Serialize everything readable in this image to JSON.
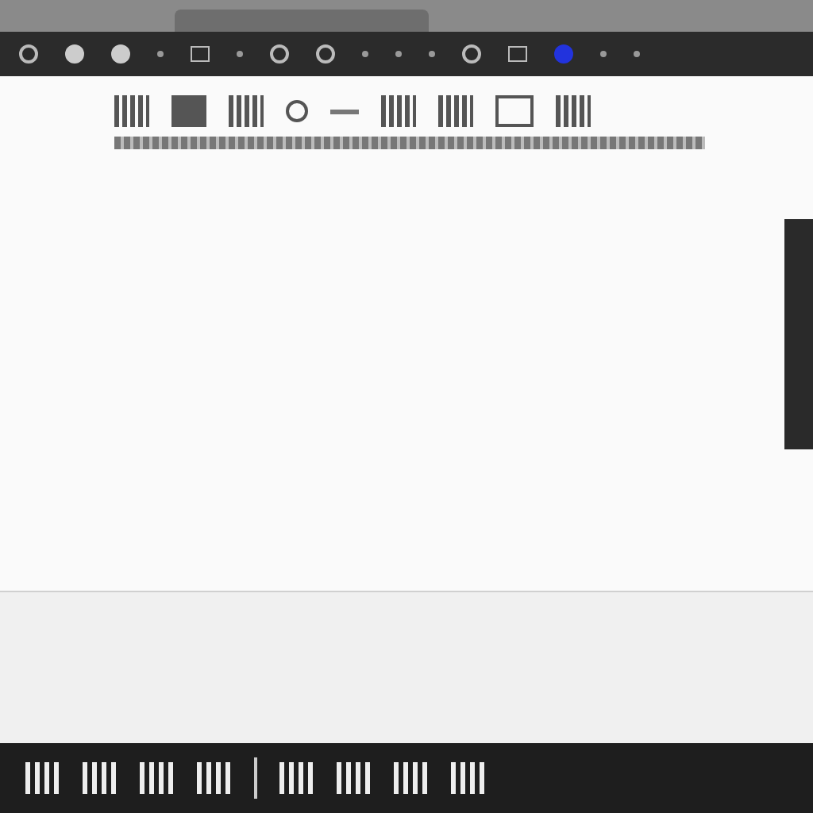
{
  "toolbar": {
    "items": [
      {
        "kind": "ring"
      },
      {
        "kind": "disc"
      },
      {
        "kind": "disc"
      },
      {
        "kind": "dot"
      },
      {
        "kind": "square"
      },
      {
        "kind": "dot"
      },
      {
        "kind": "ring"
      },
      {
        "kind": "ring"
      },
      {
        "kind": "dot"
      },
      {
        "kind": "dot"
      },
      {
        "kind": "dot"
      },
      {
        "kind": "ring"
      },
      {
        "kind": "square"
      },
      {
        "kind": "color",
        "color": "#2233dd"
      },
      {
        "kind": "dot"
      },
      {
        "kind": "dot"
      }
    ]
  },
  "ribbon": {
    "items": [
      {
        "kind": "glyph"
      },
      {
        "kind": "tile"
      },
      {
        "kind": "glyph"
      },
      {
        "kind": "ring"
      },
      {
        "kind": "bar"
      },
      {
        "kind": "glyph"
      },
      {
        "kind": "glyph"
      },
      {
        "kind": "frame"
      },
      {
        "kind": "glyph"
      }
    ]
  },
  "taskbar": {
    "items": [
      {
        "kind": "glyph"
      },
      {
        "kind": "glyph"
      },
      {
        "kind": "glyph"
      },
      {
        "kind": "glyph"
      },
      {
        "kind": "gap"
      },
      {
        "kind": "glyph"
      },
      {
        "kind": "glyph"
      },
      {
        "kind": "glyph"
      },
      {
        "kind": "glyph"
      }
    ]
  }
}
